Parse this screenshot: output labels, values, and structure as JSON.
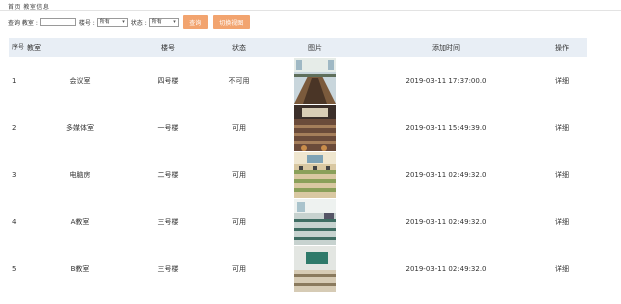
{
  "breadcrumb": "首页 教室信息",
  "search": {
    "classroom_label": "查询 教室 :",
    "classroom_value": "",
    "building_label": "楼号 :",
    "building_selected": "所有",
    "status_label": "状态 :",
    "status_selected": "所有",
    "query_button": "查询",
    "switch_button": "切换视图"
  },
  "table": {
    "headers": [
      "序号",
      "教室",
      "楼号",
      "状态",
      "图片",
      "添加时间",
      "操作"
    ],
    "rows": [
      {
        "no": "1",
        "room": "会议室",
        "building": "四号楼",
        "status": "不可用",
        "time": "2019-03-11 17:37:00.0",
        "action": "详细"
      },
      {
        "no": "2",
        "room": "多媒体室",
        "building": "一号楼",
        "status": "可用",
        "time": "2019-03-11 15:49:39.0",
        "action": "详细"
      },
      {
        "no": "3",
        "room": "电脑房",
        "building": "二号楼",
        "status": "可用",
        "time": "2019-03-11 02:49:32.0",
        "action": "详细"
      },
      {
        "no": "4",
        "room": "A教室",
        "building": "三号楼",
        "status": "可用",
        "time": "2019-03-11 02:49:32.0",
        "action": "详细"
      },
      {
        "no": "5",
        "room": "B教室",
        "building": "三号楼",
        "status": "可用",
        "time": "2019-03-11 02:49:32.0",
        "action": "详细"
      }
    ]
  },
  "colors": {
    "button": "#f2a46f",
    "header_bg": "#e8eef5"
  }
}
